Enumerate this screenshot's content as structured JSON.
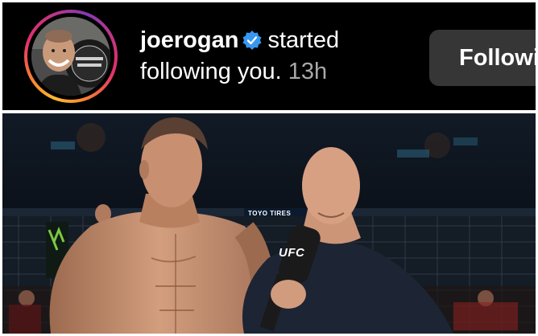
{
  "notification": {
    "username": "joerogan",
    "action": "started following you.",
    "timestamp": "13h",
    "follow_button": "Followi",
    "verified_icon": "verified-badge-icon",
    "ring_colors": [
      "#fdbb2d",
      "#f77737",
      "#e1306c",
      "#c13584",
      "#833ab4"
    ]
  },
  "photo": {
    "ufc_label": "UFC",
    "sponsor_text": "TOYO TIRES"
  },
  "colors": {
    "background": "#000000",
    "button_bg": "#363636",
    "verified_blue": "#3897f0",
    "muted_text": "#a8a8a8"
  }
}
